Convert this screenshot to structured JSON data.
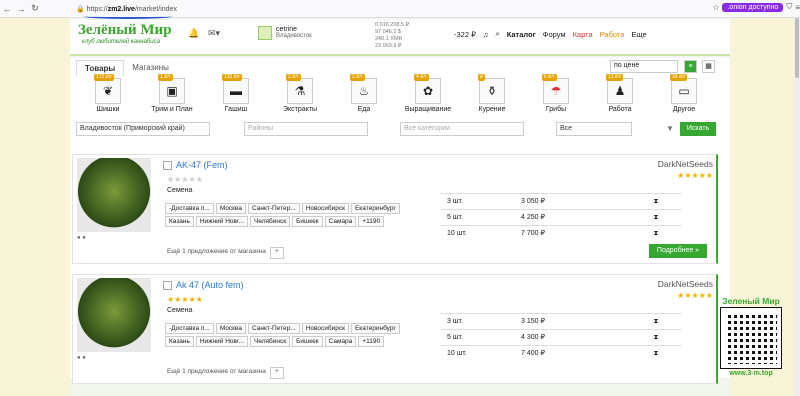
{
  "browser": {
    "url_host": "zm2.live",
    "url_path": "/market/index",
    "onion": ".onion доступно"
  },
  "header": {
    "logo_main": "Зелёный Мир",
    "logo_sub": "клуб любителей каннабиса",
    "user": "cetrine",
    "city": "Владивосток",
    "balance": [
      "0 016 208.5 ₽",
      "97 046.2 $",
      "240.1 XMR",
      "23 063.9 ₽"
    ],
    "cart_value": "-322 ₽",
    "nav": {
      "catalog": "Каталог",
      "forum": "Форум",
      "map": "Карта",
      "work": "Работа",
      "more": "Еще"
    }
  },
  "tabs": [
    "Товары",
    "Магазины"
  ],
  "sort": "по цене",
  "categories": [
    {
      "label": "Шишки",
      "badge": "172 ₽/г",
      "icon": "leaf-icon"
    },
    {
      "label": "Трим и План",
      "badge": "1 ₽/г",
      "icon": "bag-icon"
    },
    {
      "label": "Гашиш",
      "badge": "132 ₽/г",
      "icon": "hash-icon"
    },
    {
      "label": "Экстракты",
      "badge": "2 ₽/г",
      "icon": "bottle-icon"
    },
    {
      "label": "Еда",
      "badge": "2 ₽/г",
      "icon": "food-icon"
    },
    {
      "label": "Выращивание",
      "badge": "4 ₽/г",
      "icon": "plant-icon"
    },
    {
      "label": "Курение",
      "badge": "₽",
      "icon": "bong-icon"
    },
    {
      "label": "Грибы",
      "badge": "6 ₽/г",
      "icon": "mushroom-icon"
    },
    {
      "label": "Работа",
      "badge": "13 ₽/г",
      "icon": "work-icon"
    },
    {
      "label": "Другое",
      "badge": "34 ₽/г",
      "icon": "screen-icon"
    }
  ],
  "filters": {
    "region": "Владивосток (Приморский край)",
    "districts": "Районы",
    "all_categories": "Все категории",
    "all": "Все",
    "search": "Искать"
  },
  "products": [
    {
      "title": "AK-47 (Fem)",
      "type": "Семена",
      "seller": "DarkNetSeeds",
      "tags": [
        "-Доставка п...",
        "Москва",
        "Санкт-Петер...",
        "Новосибирск",
        "Екатеринбург",
        "Казань",
        "Нижний Новг...",
        "Челябинск",
        "Бишкек",
        "Самара",
        "+1190"
      ],
      "more": "Ещё 1 предложение от магазина",
      "prices": [
        {
          "q": "3 шт.",
          "p": "3 050 ₽"
        },
        {
          "q": "5 шт.",
          "p": "4 250 ₽"
        },
        {
          "q": "10 шт.",
          "p": "7 700 ₽"
        }
      ],
      "detail": "Подробнее »"
    },
    {
      "title": "Ak 47 (Auto fem)",
      "type": "Семена",
      "seller": "DarkNetSeeds",
      "tags": [
        "-Доставка п...",
        "Москва",
        "Санкт-Петер...",
        "Новосибирск",
        "Екатеринбург",
        "Казань",
        "Нижний Новг...",
        "Челябинск",
        "Бишкек",
        "Самара",
        "+1190"
      ],
      "more": "Ещё 1 предложение от магазина",
      "prices": [
        {
          "q": "3 шт.",
          "p": "3 150 ₽"
        },
        {
          "q": "5 шт.",
          "p": "4 300 ₽"
        },
        {
          "q": "10 шт.",
          "p": "7 400 ₽"
        }
      ],
      "detail": "Подробнее »"
    }
  ],
  "banner": {
    "title": "Зеленый Мир",
    "url": "www.3-m.top"
  }
}
